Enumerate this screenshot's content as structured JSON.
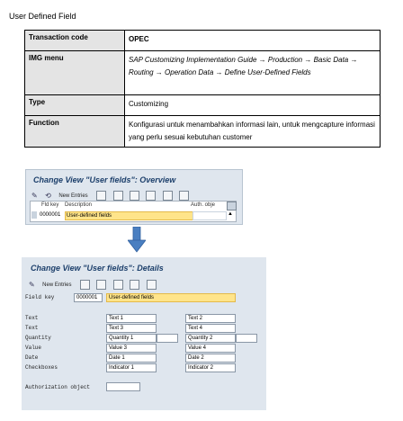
{
  "title": "User Defined Field",
  "info_table": {
    "rows": [
      {
        "key": "Transaction code",
        "value": "OPEC"
      },
      {
        "key": "IMG menu",
        "value": "SAP Customizing Implementation Guide → Production → Basic Data → Routing → Operation Data →  Define User-Defined Fields"
      },
      {
        "key": "Type",
        "value": "Customizing"
      },
      {
        "key": "Function",
        "value": "Konfigurasi untuk menambahkan informasi lain, untuk mengcapture informasi yang perlu sesuai kebutuhan customer"
      }
    ]
  },
  "overview": {
    "title": "Change View \"User fields\": Overview",
    "new_entries": "New Entries",
    "headers": {
      "key": "Fld key",
      "description": "Description",
      "auth": "Auth. obje"
    },
    "row": {
      "key": "0000001",
      "description": "User-defined fields"
    }
  },
  "details": {
    "title": "Change View \"User fields\": Details",
    "new_entries": "New Entries",
    "field_key_label": "Field key",
    "field_key_value": "0000001",
    "field_key_desc": "User-defined fields",
    "labels": [
      "Text",
      "Text",
      "Quantity",
      "Value",
      "Date",
      "Checkboxes"
    ],
    "col1": [
      "Text 1",
      "Text 3",
      "Quantity 1",
      "Value 3",
      "Date 1",
      "Indicator 1"
    ],
    "col2": [
      "Text 2",
      "Text 4",
      "Quantity 2",
      "Value 4",
      "Date 2",
      "Indicator 2"
    ],
    "auth_label": "Authorization object"
  },
  "colors": {
    "highlight": "#ffe48a",
    "sap_title": "#1c3f6b",
    "arrow": "#4a7fc1"
  }
}
